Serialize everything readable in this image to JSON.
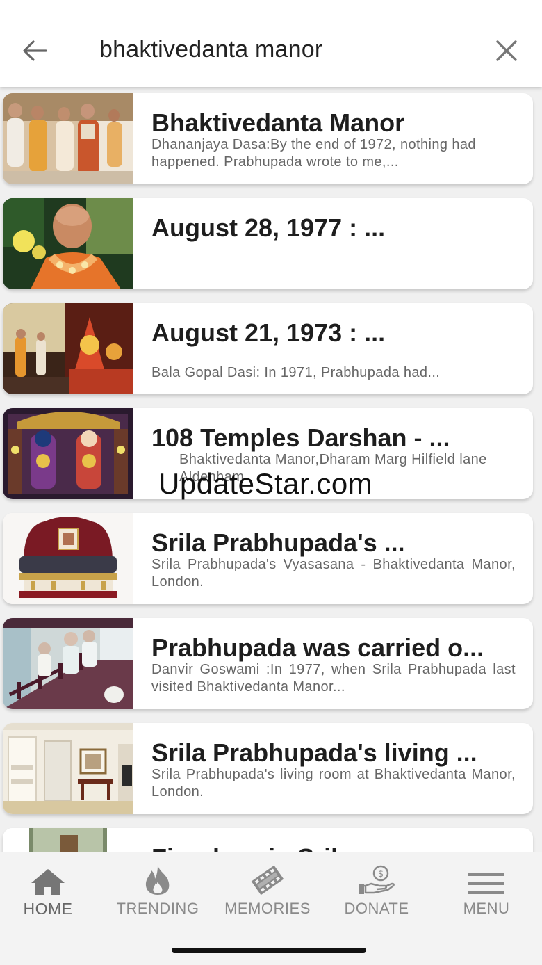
{
  "search": {
    "query": "bhaktivedanta manor"
  },
  "results": [
    {
      "title": "Bhaktivedanta Manor",
      "description": "Dhananjaya Dasa:By the end of 1972, nothing had happened. Prabhupada wrote to me,..."
    },
    {
      "title": "August 28, 1977 : ...",
      "description": ""
    },
    {
      "title": "August 21, 1973 : ...",
      "description": "Bala Gopal Dasi: In 1971, Prabhupada had..."
    },
    {
      "title": "108 Temples Darshan - ...",
      "description": "Bhaktivedanta Manor,Dharam Marg Hilfield lane Aldenham"
    },
    {
      "title": "Srila Prabhupada's ...",
      "description": "Srila Prabhupada's Vyasasana - Bhaktivedanta Manor, London."
    },
    {
      "title": "Prabhupada was carried o...",
      "description": "Danvir Goswami :In 1977, when Srila Prabhupada last visited Bhaktivedanta Manor..."
    },
    {
      "title": "Srila Prabhupada's living ...",
      "description": "Srila Prabhupada's living room at Bhaktivedanta Manor, London."
    },
    {
      "title": "Fireplace in Srila",
      "description": ""
    }
  ],
  "watermark": "UpdateStar.com",
  "nav": {
    "home": "HOME",
    "trending": "TRENDING",
    "memories": "MEMORIES",
    "donate": "DONATE",
    "menu": "MENU"
  },
  "icons": {
    "back": "arrow-left-icon",
    "clear": "close-icon",
    "home": "home-icon",
    "trending": "flame-icon",
    "memories": "film-icon",
    "donate": "hand-coin-icon",
    "menu": "hamburger-icon"
  }
}
